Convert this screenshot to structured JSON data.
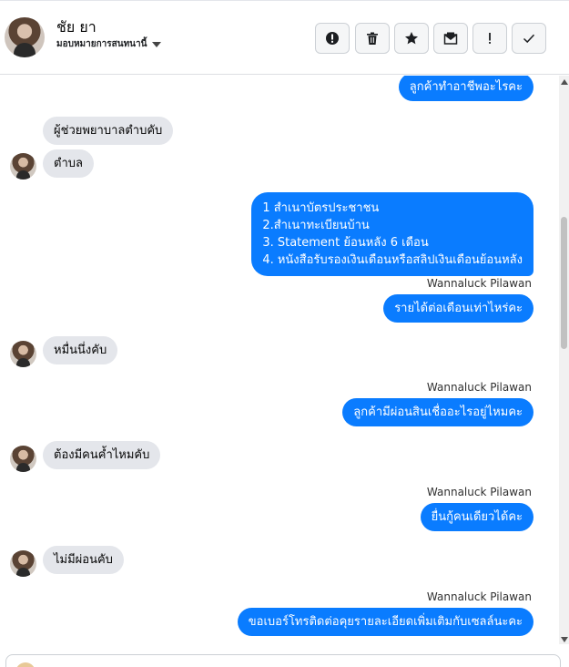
{
  "header": {
    "contact_name": "ชัย ยา",
    "assign_label": "มอบหมายการสนทนานี้",
    "avatar_icon": "contact-avatar",
    "actions": [
      {
        "name": "spam-icon-button",
        "icon": "exclamation-circle-icon"
      },
      {
        "name": "delete-button",
        "icon": "trash-icon"
      },
      {
        "name": "star-button",
        "icon": "star-icon"
      },
      {
        "name": "unread-button",
        "icon": "envelope-icon"
      },
      {
        "name": "follow-up-button",
        "icon": "exclamation-icon"
      },
      {
        "name": "done-button",
        "icon": "check-icon"
      }
    ]
  },
  "messages": {
    "m1": "ลูกค้าทำอาชีพอะไรคะ",
    "m2": "ผู้ช่วยพยาบาลตำบคับ",
    "m3": "ตำบล",
    "m4_line1": "1 สำเนาบัตรประชาชน",
    "m4_line2": "2.สำเนาทะเบียนบ้าน",
    "m4_line3": " 3. Statement ย้อนหลัง 6 เดือน",
    "m4_line4": "4. หนังสือรับรองเงินเดือนหรือสลิปเงินเดือนย้อนหลัง",
    "sender1": "Wannaluck Pilawan",
    "m5": "รายได้ต่อเดือนเท่าไหร่คะ",
    "m6": "หมื่นนึ่งคับ",
    "sender2": "Wannaluck Pilawan",
    "m7": "ลูกค้ามีผ่อนสินเชื่ออะไรอยู่ไหมคะ",
    "m8": "ต้องมีคนค้ำไหมคับ",
    "sender3": "Wannaluck Pilawan",
    "m9": "ยื่นกู้คนเดียวได้คะ",
    "m10": "ไม่มีผ่อนคับ",
    "sender4": "Wannaluck Pilawan",
    "m11": "ขอเบอร์โทรติดต่อคุยรายละเอียดเพิ่มเติมกับเซลล์นะคะ"
  },
  "colors": {
    "outgoing_bubble": "#0a7cff",
    "incoming_bubble": "#e4e6eb"
  }
}
